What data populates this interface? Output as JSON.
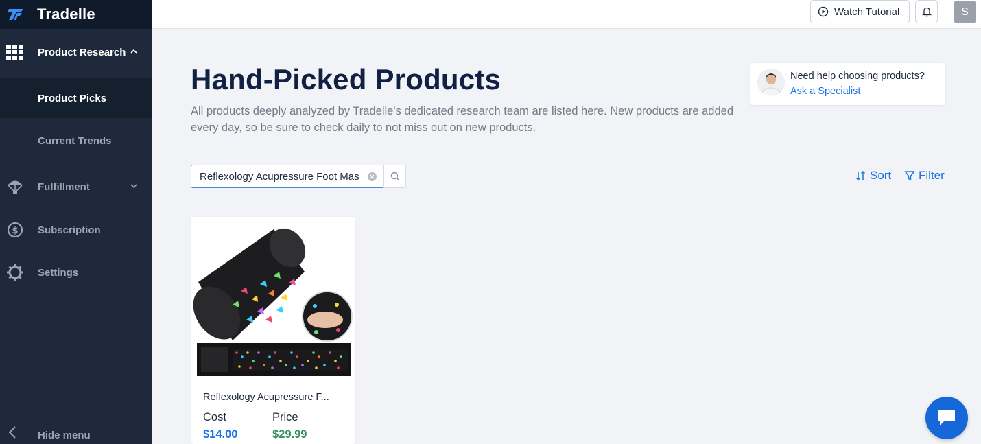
{
  "brand": {
    "name": "Tradelle"
  },
  "sidebar": {
    "product_research": "Product Research",
    "product_picks": "Product Picks",
    "current_trends": "Current Trends",
    "fulfillment": "Fulfillment",
    "subscription": "Subscription",
    "settings": "Settings",
    "hide_menu": "Hide menu"
  },
  "topbar": {
    "watch_tutorial": "Watch Tutorial",
    "avatar_initial": "S"
  },
  "main": {
    "title": "Hand-Picked Products",
    "description": "All products deeply analyzed by Tradelle's dedicated research team are listed here. New products are added every day, so be sure to check daily to not miss out on new products.",
    "help_question": "Need help choosing products?",
    "help_link": "Ask a Specialist",
    "search_value": "Reflexology Acupressure Foot Mas",
    "sort_label": "Sort",
    "filter_label": "Filter"
  },
  "products": [
    {
      "name": "Reflexology Acupressure F...",
      "cost_label": "Cost",
      "price_label": "Price",
      "cost": "$14.00",
      "price": "$29.99"
    }
  ],
  "colors": {
    "sidebar_bg": "#1e2a3b",
    "accent": "#1a73e8",
    "price_green": "#2f8f5e",
    "title_navy": "#102143"
  }
}
